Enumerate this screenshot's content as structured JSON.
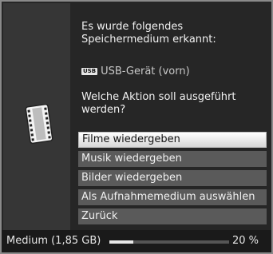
{
  "dialog": {
    "message": [
      "Es wurde folgendes",
      "Speichermedium erkannt:"
    ],
    "device_icon": "usb-icon",
    "device_badge": "USB",
    "device_label": "USB-Gerät (vorn)",
    "question": [
      "Welche Aktion soll ausgeführt",
      "werden?"
    ],
    "side_icon": "film-icon"
  },
  "menu": {
    "items": [
      {
        "label": "Filme wiedergeben",
        "selected": true
      },
      {
        "label": "Musik wiedergeben",
        "selected": false
      },
      {
        "label": "Bilder wiedergeben",
        "selected": false
      },
      {
        "label": "Als Aufnahmemedium auswählen",
        "selected": false
      },
      {
        "label": "Zurück",
        "selected": false
      }
    ]
  },
  "status": {
    "label": "Medium (1,85 GB)",
    "progress": 0.2,
    "percent_text": "20 %"
  },
  "colors": {
    "selected_bg": "#f2f2f2",
    "item_bg": "#5a5a5a",
    "panel_bg": "#363636"
  }
}
